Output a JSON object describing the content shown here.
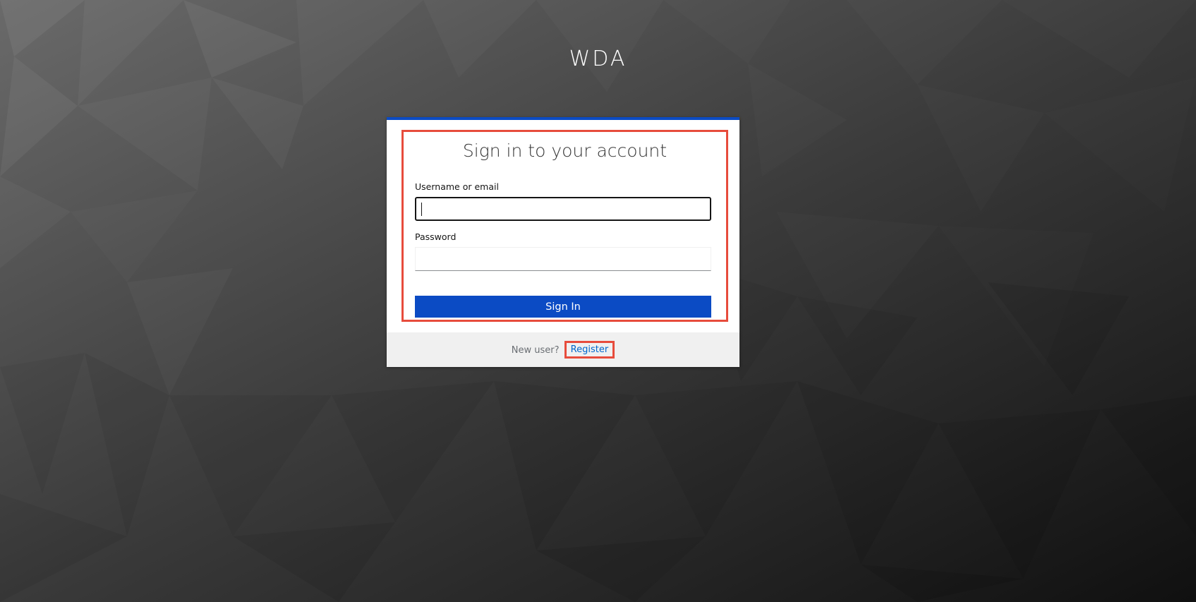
{
  "realm": {
    "title": "WDA"
  },
  "login": {
    "heading": "Sign in to your account",
    "username_label": "Username or email",
    "username_value": "",
    "password_label": "Password",
    "password_value": "",
    "submit_label": "Sign In"
  },
  "footer": {
    "new_user_text": "New user?",
    "register_label": "Register"
  },
  "colors": {
    "accent": "#0b4bc4",
    "highlight_box": "#e74c3c",
    "link": "#0066cc",
    "footer_bg": "#f0f0f0"
  }
}
